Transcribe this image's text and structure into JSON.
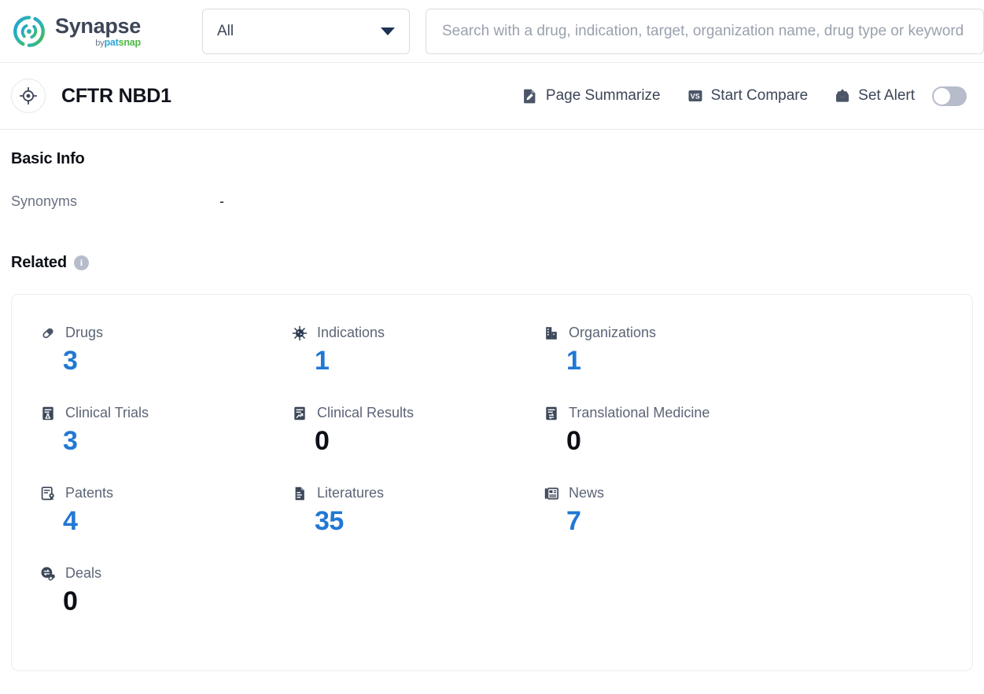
{
  "brand": {
    "name": "Synapse",
    "by": "by",
    "pat": "pat",
    "snap": "snap",
    "logo_icon": "synapse-circle-logo"
  },
  "search": {
    "scope_label": "All",
    "scope_icon": "chevron-down-icon",
    "placeholder": "Search with a drug, indication, target, organization name, drug type or keyword",
    "value": ""
  },
  "entity": {
    "avatar_icon": "target-crosshair-icon",
    "title": "CFTR NBD1",
    "actions": [
      {
        "label": "Page Summarize",
        "icon": "document-pencil-icon"
      },
      {
        "label": "Start Compare",
        "icon": "vs-badge-icon"
      },
      {
        "label": "Set Alert",
        "icon": "inbox-up-arrow-icon"
      }
    ],
    "alert_toggle_on": false
  },
  "basic_info": {
    "title": "Basic Info",
    "fields": [
      {
        "key": "Synonyms",
        "value": "-"
      }
    ]
  },
  "related": {
    "title": "Related",
    "info_icon": "info-icon",
    "info_glyph": "i",
    "stats": [
      {
        "label": "Drugs",
        "value": "3",
        "icon": "pill-capsule-icon",
        "highlight": true
      },
      {
        "label": "Indications",
        "value": "1",
        "icon": "virus-icon",
        "highlight": true
      },
      {
        "label": "Organizations",
        "value": "1",
        "icon": "building-icon",
        "highlight": true
      },
      {
        "label": "Clinical Trials",
        "value": "3",
        "icon": "clipboard-flask-icon",
        "highlight": true
      },
      {
        "label": "Clinical Results",
        "value": "0",
        "icon": "clipboard-chart-icon",
        "highlight": false
      },
      {
        "label": "Translational Medicine",
        "value": "0",
        "icon": "clipboard-exchange-icon",
        "highlight": false
      },
      {
        "label": "Patents",
        "value": "4",
        "icon": "patent-seal-icon",
        "highlight": true
      },
      {
        "label": "Literatures",
        "value": "35",
        "icon": "literature-doc-icon",
        "highlight": true
      },
      {
        "label": "News",
        "value": "7",
        "icon": "news-paper-icon",
        "highlight": true
      },
      {
        "label": "Deals",
        "value": "0",
        "icon": "deal-exchange-icon",
        "highlight": false
      }
    ]
  },
  "colors": {
    "accent_blue": "#2178d4",
    "icon_navy": "#4b5567",
    "text_dark": "#0d1017",
    "text_muted": "#5c6476",
    "toggle_off": "#b6bcca"
  }
}
